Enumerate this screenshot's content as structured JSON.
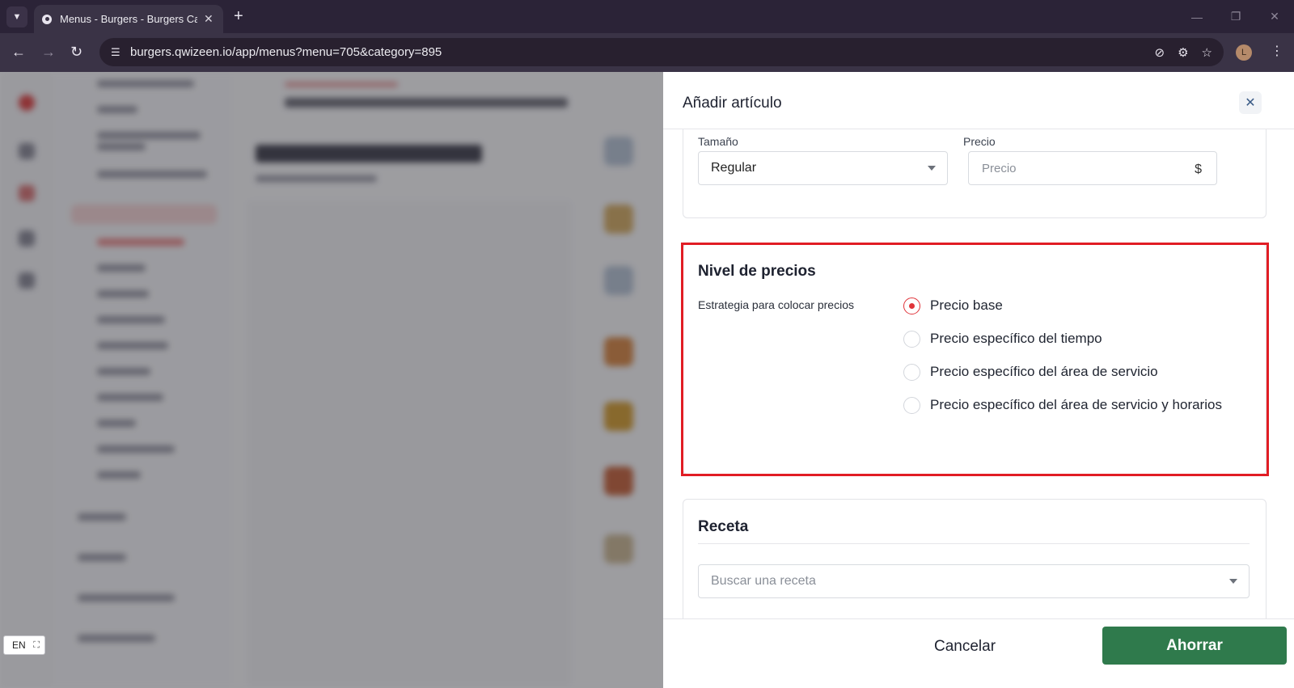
{
  "browser": {
    "tab_title": "Menus - Burgers - Burgers Cate",
    "url": "burgers.qwizeen.io/app/menus?menu=705&category=895",
    "avatar_initial": "L"
  },
  "language_badge": {
    "code": "EN"
  },
  "drawer": {
    "title": "Añadir artículo",
    "size_section": {
      "size_label": "Tamaño",
      "size_value": "Regular",
      "price_label": "Precio",
      "price_placeholder": "Precio",
      "price_suffix": "$"
    },
    "pricing_section": {
      "title": "Nivel de precios",
      "strategy_label": "Estrategia para colocar precios",
      "options": [
        {
          "label": "Precio base",
          "checked": true
        },
        {
          "label": "Precio específico del tiempo",
          "checked": false
        },
        {
          "label": "Precio específico del área de servicio",
          "checked": false
        },
        {
          "label": "Precio específico del área de servicio y horarios",
          "checked": false
        }
      ]
    },
    "recipe_section": {
      "title": "Receta",
      "search_placeholder": "Buscar una receta"
    },
    "footer": {
      "cancel_label": "Cancelar",
      "save_label": "Ahorrar"
    }
  },
  "colors": {
    "accent_red": "#e0343a",
    "highlight_red": "#e11d24",
    "save_green": "#2f7a4c"
  }
}
